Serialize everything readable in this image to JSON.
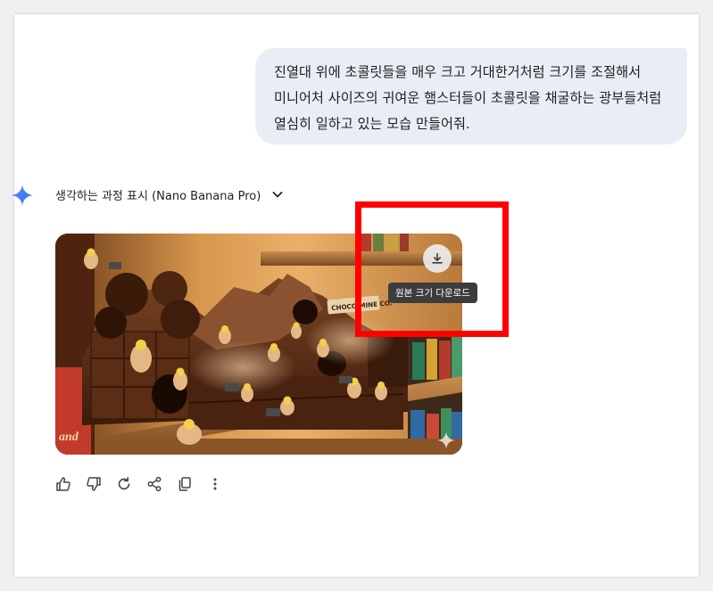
{
  "user_message": {
    "text": "진열대 위에 초콜릿들을 매우 크고 거대한거처럼 크기를 조절해서 미니어처 사이즈의 귀여운 햄스터들이 초콜릿을 채굴하는 광부들처럼 열심히 일하고 있는 모습 만들어줘."
  },
  "response": {
    "thinking_label": "생각하는 과정 표시 (Nano Banana Pro)",
    "image": {
      "sign_text": "CHOCO MINE CO.",
      "box_text": "and",
      "download_tooltip": "원본 크기 다운로드"
    }
  },
  "icons": {
    "gemini": "gemini-sparkle-icon",
    "thinking_toggle": "chevron-down-icon",
    "download": "download-icon",
    "watermark": "sparkle-watermark-icon",
    "actions": [
      "thumb-up-icon",
      "thumb-down-icon",
      "redo-icon",
      "share-icon",
      "copy-icon",
      "more-vertical-icon"
    ]
  },
  "colors": {
    "bubble_bg": "#e9eef6",
    "text": "#1f1f1f",
    "highlight": "#ff0000",
    "gemini_blue": "#4285f4"
  }
}
